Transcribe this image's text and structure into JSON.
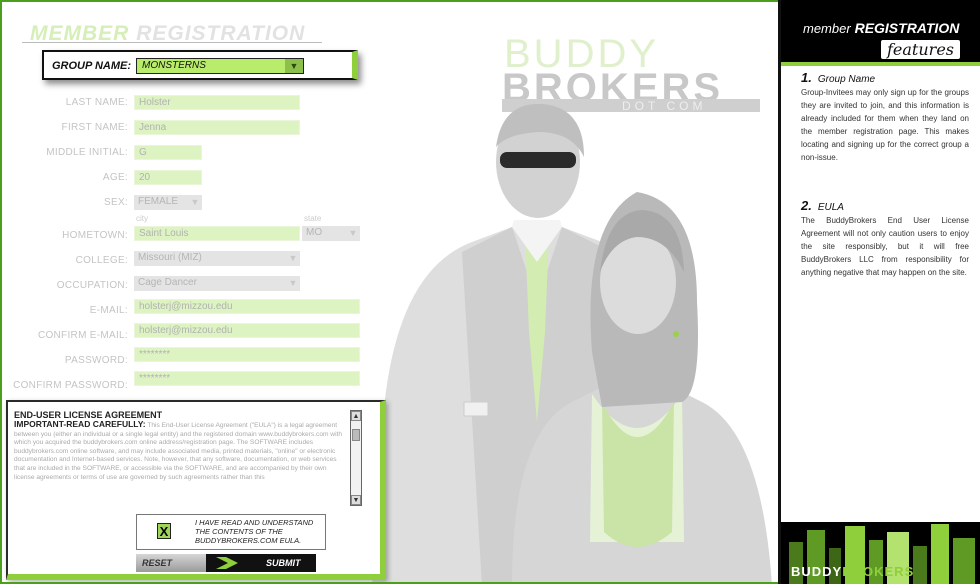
{
  "header": {
    "title_part1": "MEMBER",
    "title_part2": "REGISTRATION"
  },
  "group": {
    "label": "GROUP NAME:",
    "value": "MONSTERNS"
  },
  "brand": {
    "line1": "BUDDY",
    "line2": "BROKERS",
    "line3": "DOT COM"
  },
  "form": {
    "last_name": {
      "label": "LAST NAME:",
      "value": "Holster"
    },
    "first_name": {
      "label": "FIRST NAME:",
      "value": "Jenna"
    },
    "middle_initial": {
      "label": "MIDDLE INITIAL:",
      "value": "G"
    },
    "age": {
      "label": "AGE:",
      "value": "20"
    },
    "sex": {
      "label": "SEX:",
      "value": "FEMALE"
    },
    "hometown": {
      "label": "HOMETOWN:",
      "city_hint": "city",
      "state_hint": "state",
      "city": "Saint Louis",
      "state": "MO"
    },
    "college": {
      "label": "COLLEGE:",
      "value": "Missouri (MIZ)"
    },
    "occupation": {
      "label": "OCCUPATION:",
      "value": "Cage Dancer"
    },
    "email": {
      "label": "E-MAIL:",
      "value": "holsterj@mizzou.edu"
    },
    "confirm_email": {
      "label": "CONFIRM E-MAIL:",
      "value": "holsterj@mizzou.edu"
    },
    "password": {
      "label": "PASSWORD:",
      "value": "********"
    },
    "confirm_password": {
      "label": "CONFIRM PASSWORD:",
      "value": "********"
    }
  },
  "eula": {
    "title": "END-USER LICENSE AGREEMENT",
    "important": "IMPORTANT-READ CAREFULLY:",
    "body": "This End-User License Agreement (\"EULA\") is a legal agreement between you (either an individual or a single legal entity) and the registered domain www.buddybrokers.com with which you acquired the buddybrokers.com online address/registration page. The SOFTWARE includes buddybrokers.com online software, and may include associated media, printed materials, \"online\" or electronic documentation and Internet-based services. Note, however, that any software, documentation, or web services that are included in the SOFTWARE, or accessible via the SOFTWARE, and are accompanied by their own license agreements or terms of use are governed by such agreements rather than this",
    "agree_text": "I HAVE READ AND UNDERSTAND THE CONTENTS OF THE BUDDYBROKERS.COM EULA.",
    "check_mark": "X"
  },
  "buttons": {
    "reset": "RESET",
    "submit": "SUBMIT"
  },
  "panel": {
    "heading_lower": "member",
    "heading_upper": "REGISTRATION",
    "subheading": "features",
    "item1": {
      "number": "1.",
      "title": "Group Name",
      "body": "Group-Invitees may only sign up for the groups they are invited to join, and this information is already included for them when they land on the member registration page. This makes locating and signing up for the correct group a non-issue."
    },
    "item2": {
      "number": "2.",
      "title": "EULA",
      "body": "The BuddyBrokers End User License Agreement will not only caution users to enjoy the site responsibly, but it will free BuddyBrokers LLC from responsibility for anything negative that may happen on the site."
    },
    "logo_part1": "BUDDY",
    "logo_part2": "BROKERS"
  },
  "colors": {
    "accent_green": "#8fcf3c",
    "field_green": "#ddf3c2",
    "dark": "#111111"
  }
}
